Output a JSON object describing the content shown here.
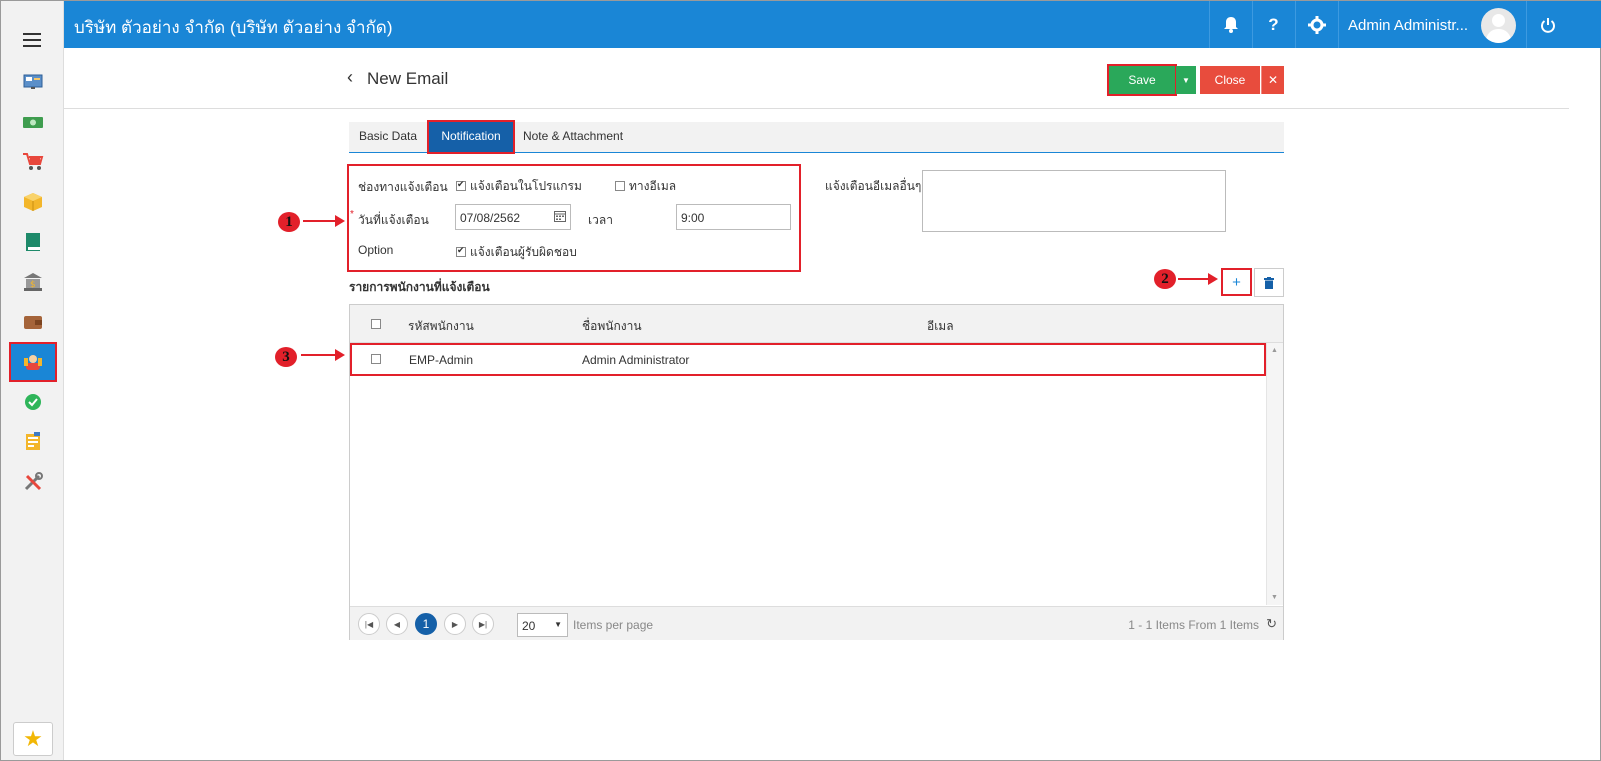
{
  "header": {
    "company": "บริษัท ตัวอย่าง จำกัด (บริษัท ตัวอย่าง จำกัด)",
    "user_name": "Admin Administr...",
    "icons": [
      "bell-icon",
      "help-icon",
      "gear-icon",
      "avatar",
      "power-icon"
    ],
    "help_glyph": "?"
  },
  "sidebar": {
    "items": [
      "dashboard-icon",
      "money-icon",
      "cart-icon",
      "box-icon",
      "book-icon",
      "bank-icon",
      "wallet-icon",
      "employee-icon",
      "check-icon",
      "report-icon",
      "tools-icon"
    ],
    "active_item": "employee-icon",
    "favorite_icon": "star-icon"
  },
  "page": {
    "title": "New Email",
    "save_label": "Save",
    "close_label": "Close"
  },
  "tabs": [
    "Basic Data",
    "Notification",
    "Note & Attachment"
  ],
  "active_tab": "Notification",
  "form": {
    "channel_label": "ช่องทางแจ้งเตือน",
    "in_app_label": "แจ้งเตือนในโปรแกรม",
    "in_app_checked": true,
    "email_label": "ทางอีเมล",
    "email_checked": false,
    "date_label": "วันที่แจ้งเตือน",
    "required_mark": "*",
    "date_value": "07/08/2562",
    "time_label": "เวลา",
    "time_value": "9:00",
    "option_label": "Option",
    "notify_owner_label": "แจ้งเตือนผู้รับผิดชอบ",
    "notify_owner_checked": true,
    "other_email_label": "แจ้งเตือนอีเมลอื่นๆ",
    "other_email_value": ""
  },
  "employees": {
    "title": "รายการพนักงานที่แจ้งเตือน",
    "add_glyph": "+",
    "columns": [
      "รหัสพนักงาน",
      "ชื่อพนักงาน",
      "อีเมล"
    ],
    "rows": [
      {
        "code": "EMP-Admin",
        "name": "Admin Administrator",
        "email": ""
      }
    ]
  },
  "pager": {
    "current_page": "1",
    "page_size": "20",
    "items_per_page_label": "Items per page",
    "summary": "1 - 1 Items From 1 Items"
  },
  "annotations": [
    "1",
    "2",
    "3"
  ],
  "colors": {
    "brand_blue": "#1a86d6",
    "active_tab": "#1560a8",
    "save_green": "#2aa85a",
    "close_red": "#e84c3d",
    "highlight_red": "#e2202a"
  }
}
